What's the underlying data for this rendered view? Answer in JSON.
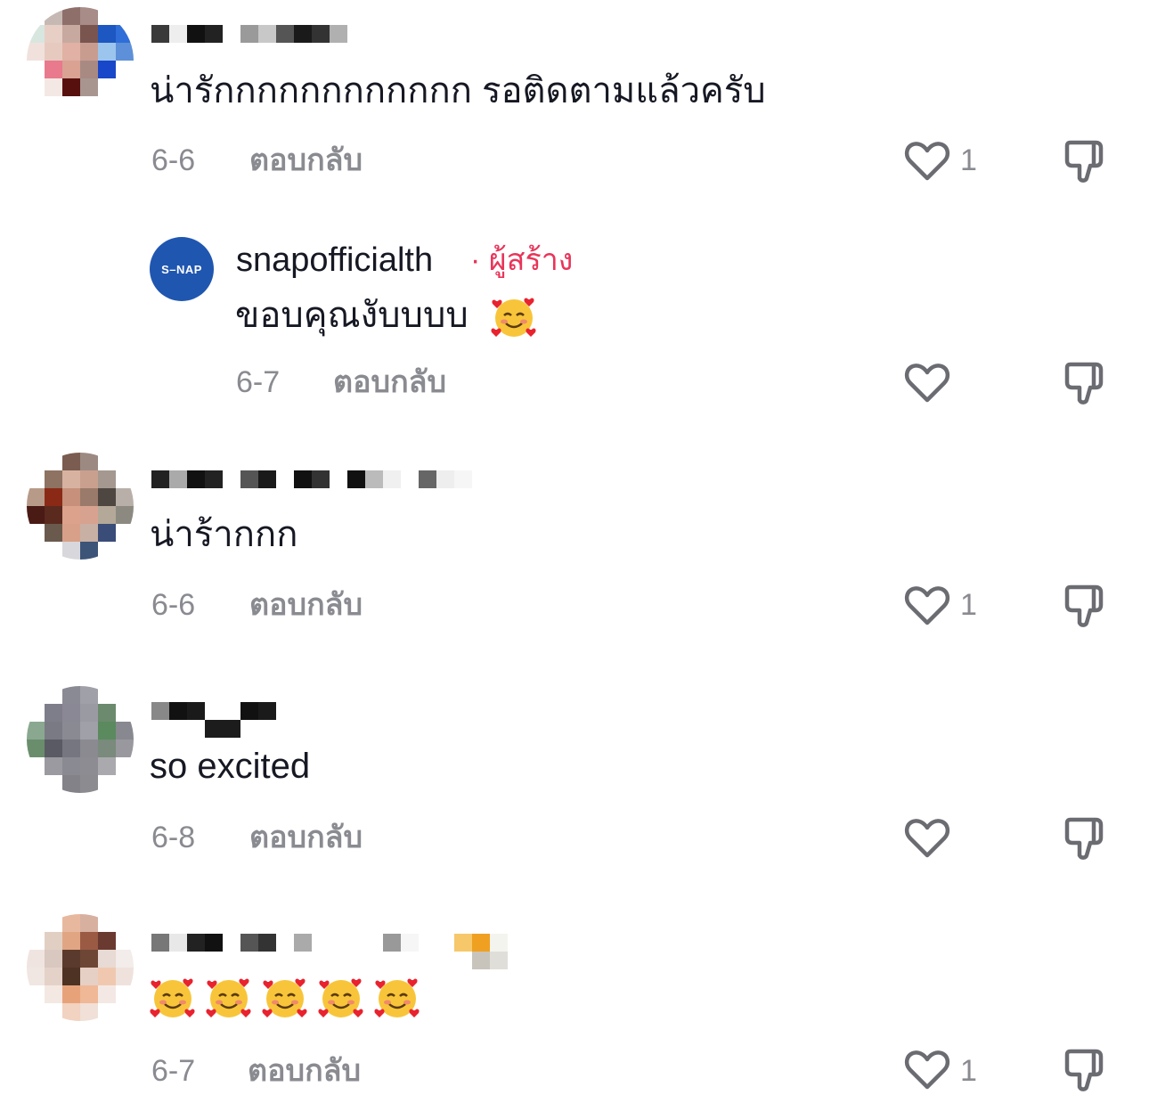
{
  "comments": [
    {
      "text": "น่ารักกกกกกกกกกกก รอติดตามแล้วครับ",
      "date": "6-6",
      "reply_label": "ตอบกลับ",
      "like_count": "1",
      "replies": [
        {
          "username": "snapofficialth",
          "badge": "· ผู้สร้าง",
          "avatar_text": "S–NAP",
          "text": "ขอบคุณงับบบบ",
          "emoji": "smiling-face-with-hearts",
          "date": "6-7",
          "reply_label": "ตอบกลับ"
        }
      ]
    },
    {
      "text": "น่าร้ากกก",
      "date": "6-6",
      "reply_label": "ตอบกลับ",
      "like_count": "1"
    },
    {
      "text": "so excited",
      "date": "6-8",
      "reply_label": "ตอบกลับ",
      "like_count": ""
    },
    {
      "emoji_count": 5,
      "emoji": "smiling-face-with-hearts",
      "date": "6-7",
      "reply_label": "ตอบกลับ",
      "like_count": "1"
    }
  ],
  "colors": {
    "accent_creator": "#e8355a",
    "meta_text": "#8a8b91",
    "icon_stroke": "#6b6c72",
    "creator_avatar_bg": "#1f56b0"
  }
}
